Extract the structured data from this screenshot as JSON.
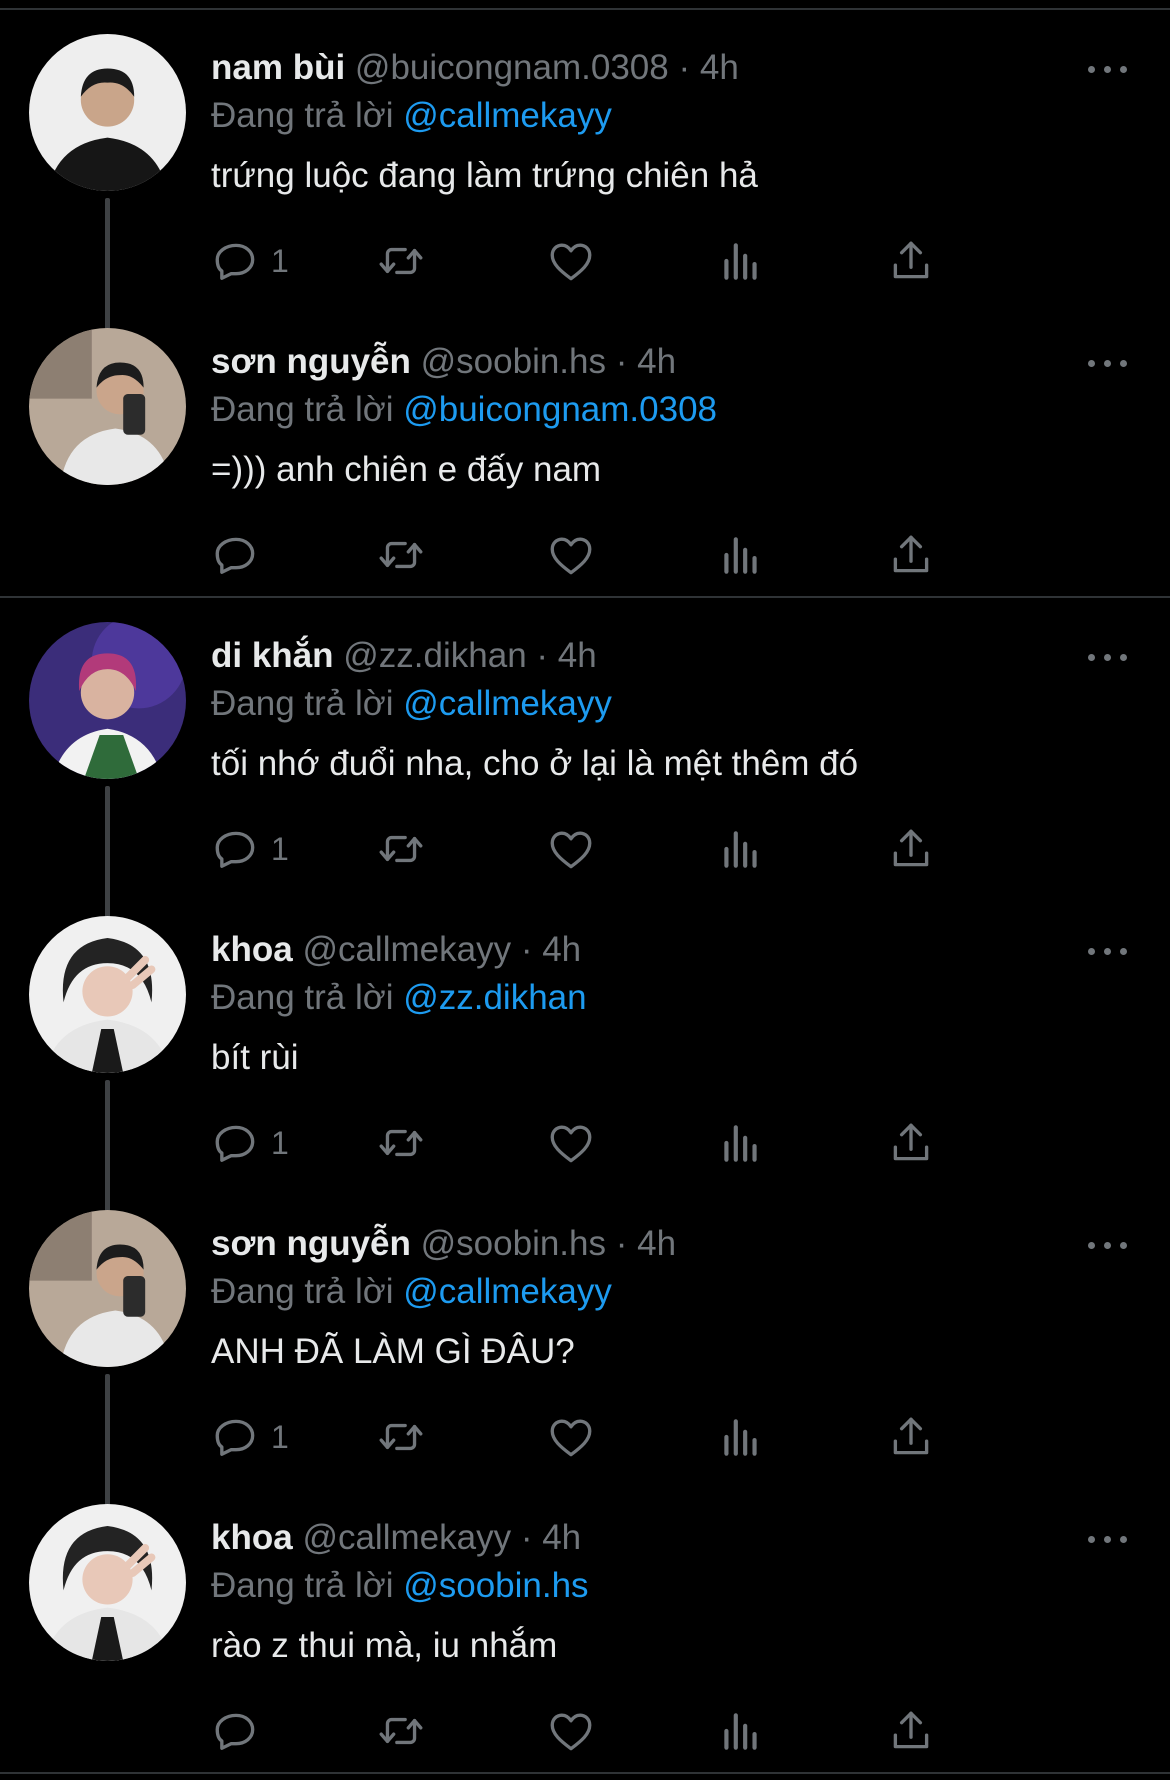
{
  "tweets": [
    {
      "name": "nam bùi",
      "handle": "@buicongnam.0308",
      "dot": "·",
      "time": "4h",
      "reply_prefix": "Đang trả lời",
      "reply_to": "@callmekayy",
      "text": "trứng luộc đang làm trứng chiên hả",
      "reply_count": "1",
      "avatar": "avatar-nam"
    },
    {
      "name": "sơn nguyễn",
      "handle": "@soobin.hs",
      "dot": "·",
      "time": "4h",
      "reply_prefix": "Đang trả lời",
      "reply_to": "@buicongnam.0308",
      "text": "=))) anh chiên e đấy nam",
      "reply_count": "",
      "avatar": "avatar-son"
    },
    {
      "name": "di khắn",
      "handle": "@zz.dikhan",
      "dot": "·",
      "time": "4h",
      "reply_prefix": "Đang trả lời",
      "reply_to": "@callmekayy",
      "text": "tối nhớ đuổi nha, cho ở lại là mệt thêm đó",
      "reply_count": "1",
      "avatar": "avatar-dikhan"
    },
    {
      "name": "khoa",
      "handle": "@callmekayy",
      "dot": "·",
      "time": "4h",
      "reply_prefix": "Đang trả lời",
      "reply_to": "@zz.dikhan",
      "text": "bít rùi",
      "reply_count": "1",
      "avatar": "avatar-khoa"
    },
    {
      "name": "sơn nguyễn",
      "handle": "@soobin.hs",
      "dot": "·",
      "time": "4h",
      "reply_prefix": "Đang trả lời",
      "reply_to": "@callmekayy",
      "text": "ANH ĐÃ LÀM GÌ ĐÂU?",
      "reply_count": "1",
      "avatar": "avatar-son"
    },
    {
      "name": "khoa",
      "handle": "@callmekayy",
      "dot": "·",
      "time": "4h",
      "reply_prefix": "Đang trả lời",
      "reply_to": "@soobin.hs",
      "text": "rào z thui mà, iu nhắm",
      "reply_count": "",
      "avatar": "avatar-khoa"
    }
  ],
  "icons": {
    "reply": "reply-icon",
    "retweet": "retweet-icon",
    "like": "heart-icon",
    "views": "views-icon",
    "share": "share-icon",
    "more": "more-icon"
  },
  "colors": {
    "background": "#000000",
    "accent": "#1d9bf0",
    "muted": "#71767b",
    "text": "#e7e9ea",
    "divider": "#2f3336"
  }
}
